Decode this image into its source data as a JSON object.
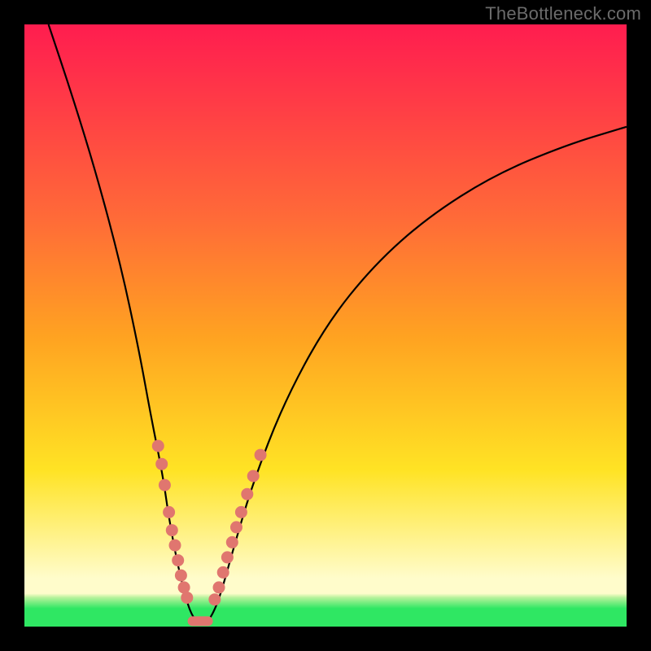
{
  "watermark": "TheBottleneck.com",
  "colors": {
    "top": "#ff1d4f",
    "red": "#ff2f4a",
    "redorange": "#ff6a38",
    "orange": "#ffa321",
    "yellow": "#ffe324",
    "paleyellow": "#fffccb",
    "greenband": "#b5f29a",
    "green": "#2fe763",
    "curve": "#000000",
    "dot": "#e0766f"
  },
  "chart_data": {
    "type": "line",
    "title": "",
    "xlabel": "",
    "ylabel": "",
    "xlim": [
      0,
      100
    ],
    "ylim": [
      0,
      100
    ],
    "curve": [
      {
        "x": 4,
        "y": 100
      },
      {
        "x": 8,
        "y": 88
      },
      {
        "x": 12,
        "y": 75
      },
      {
        "x": 16,
        "y": 60
      },
      {
        "x": 19,
        "y": 46
      },
      {
        "x": 21,
        "y": 35
      },
      {
        "x": 23,
        "y": 25
      },
      {
        "x": 24,
        "y": 18
      },
      {
        "x": 25.5,
        "y": 10
      },
      {
        "x": 27,
        "y": 4
      },
      {
        "x": 28,
        "y": 1.5
      },
      {
        "x": 29,
        "y": 0.7
      },
      {
        "x": 30,
        "y": 0.7
      },
      {
        "x": 31,
        "y": 1.5
      },
      {
        "x": 32.5,
        "y": 5
      },
      {
        "x": 35,
        "y": 14
      },
      {
        "x": 38,
        "y": 24
      },
      {
        "x": 43,
        "y": 37
      },
      {
        "x": 50,
        "y": 50
      },
      {
        "x": 58,
        "y": 60
      },
      {
        "x": 67,
        "y": 68
      },
      {
        "x": 78,
        "y": 75
      },
      {
        "x": 90,
        "y": 80
      },
      {
        "x": 100,
        "y": 83
      }
    ],
    "dots_left": [
      {
        "x": 22.2,
        "y": 30
      },
      {
        "x": 22.8,
        "y": 27
      },
      {
        "x": 23.3,
        "y": 23.5
      },
      {
        "x": 24.0,
        "y": 19
      },
      {
        "x": 24.5,
        "y": 16
      },
      {
        "x": 25.0,
        "y": 13.5
      },
      {
        "x": 25.5,
        "y": 11
      },
      {
        "x": 26.0,
        "y": 8.5
      },
      {
        "x": 26.5,
        "y": 6.5
      },
      {
        "x": 27.0,
        "y": 4.8
      }
    ],
    "dots_right": [
      {
        "x": 31.6,
        "y": 4.5
      },
      {
        "x": 32.3,
        "y": 6.5
      },
      {
        "x": 33.0,
        "y": 9
      },
      {
        "x": 33.7,
        "y": 11.5
      },
      {
        "x": 34.5,
        "y": 14
      },
      {
        "x": 35.2,
        "y": 16.5
      },
      {
        "x": 36.0,
        "y": 19
      },
      {
        "x": 37.0,
        "y": 22
      },
      {
        "x": 38.0,
        "y": 25
      },
      {
        "x": 39.2,
        "y": 28.5
      }
    ],
    "valley_lump": {
      "x_center": 29.2,
      "y": 0.9,
      "width": 4.2,
      "height": 1.6
    }
  }
}
